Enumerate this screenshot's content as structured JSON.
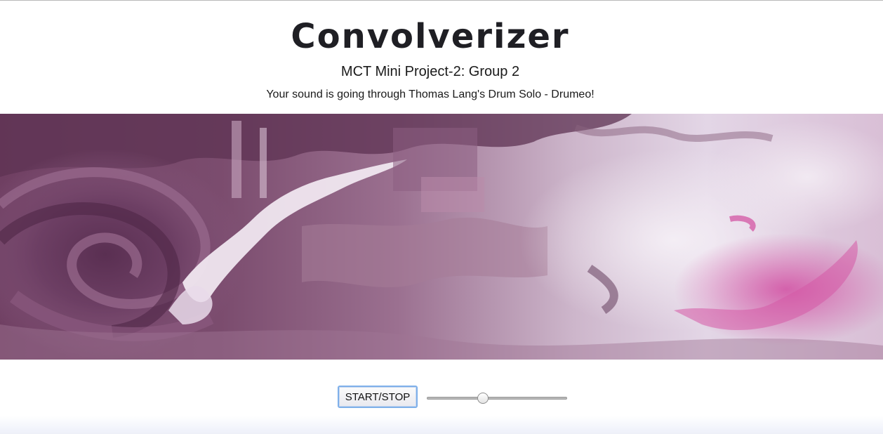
{
  "header": {
    "title": "Convolverizer",
    "subtitle": "MCT Mini Project-2: Group 2",
    "description": "Your sound is going through Thomas Lang's Drum Solo - Drumeo!"
  },
  "artwork": {
    "icon": "abstract-swirl-painting",
    "colors": [
      "#6e3f63",
      "#8d5a80",
      "#b48aa8",
      "#e8dcea",
      "#d85aa8"
    ]
  },
  "controls": {
    "start_stop_label": "START/STOP",
    "volume_slider": {
      "min": 0,
      "max": 1,
      "value": 0.4
    }
  },
  "colors": {
    "button_focus_border": "#7fb0ea",
    "title": "#1f1f24"
  }
}
